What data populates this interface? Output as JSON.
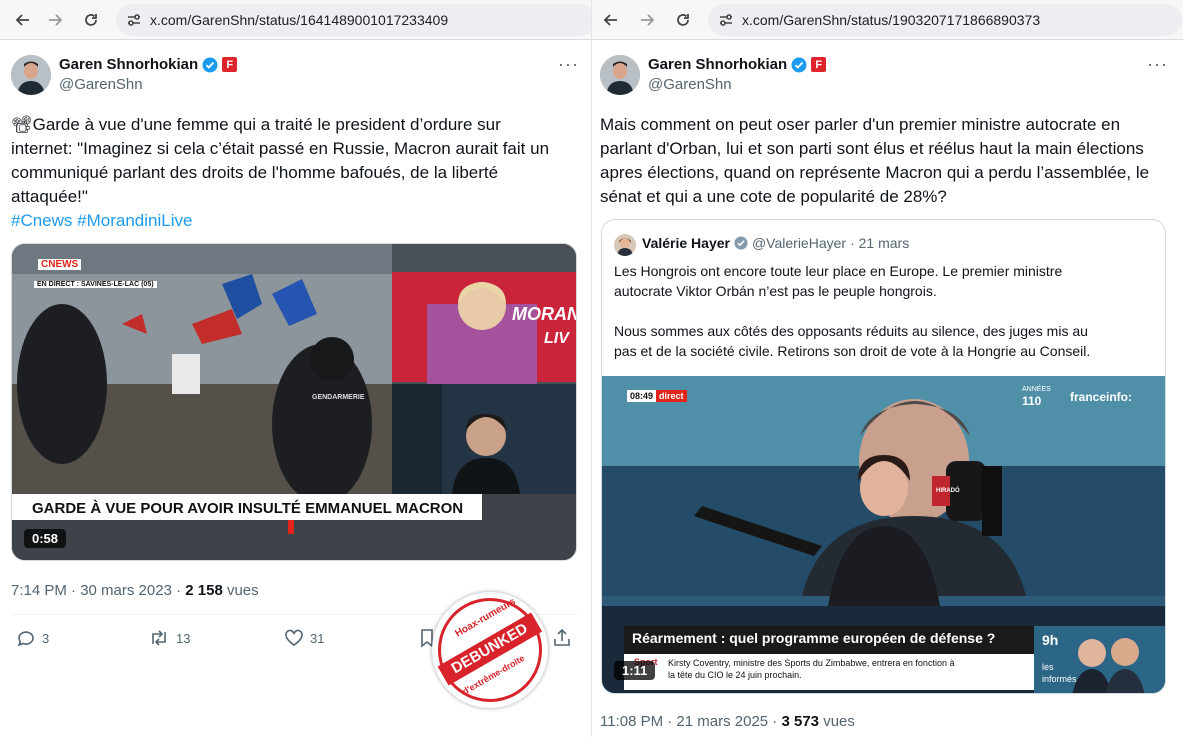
{
  "left": {
    "browser": {
      "url": "x.com/GarenShn/status/1641489001017233409"
    },
    "author": {
      "name": "Garen Shnorhokian",
      "handle": "@GarenShn",
      "affiliation_badge": "F"
    },
    "tweet": {
      "camera_emoji": "📽",
      "line1": "Garde à vue d'une femme qui a traité le president d’ordure sur",
      "line2": "internet: \"Imaginez si cela c’était passé en Russie, Macron aurait fait un",
      "line3": "communiqué parlant des droits de l'homme bafoués, de la liberté",
      "line4": "attaquée!\"",
      "hashtag1": "#Cnews",
      "hashtag2": "#MorandiniLive"
    },
    "video": {
      "channel_logo": "CNEWS",
      "live_strip": "EN DIRECT : SAVINES-LE-LAC (05)",
      "show_name_1": "MORAN",
      "show_name_2": "LIV",
      "banner": "GARDE À VUE POUR AVOIR INSULTÉ EMMANUEL MACRON",
      "duration": "0:58",
      "gendarmerie_label": "GENDARMERIE"
    },
    "meta": {
      "time": "7:14 PM · 30 mars 2023 · ",
      "views": "2 158",
      "views_label": " vues"
    },
    "actions": {
      "replies": "3",
      "retweets": "13",
      "likes": "31"
    },
    "stamp": {
      "top": "Hoax-rumeurs",
      "middle": "DEBUNKED",
      "bottom": "d'extrême-droite"
    }
  },
  "right": {
    "browser": {
      "url": "x.com/GarenShn/status/1903207171866890373"
    },
    "author": {
      "name": "Garen Shnorhokian",
      "handle": "@GarenShn",
      "affiliation_badge": "F"
    },
    "tweet": {
      "line1": "Mais comment on peut oser parler d'un premier ministre autocrate en",
      "line2": "parlant d'Orban, lui et son parti sont élus et réélus haut la main élections",
      "line3": "apres élections, quand on représente Macron qui a perdu l’assemblée, le",
      "line4": "sénat et qui a une cote de popularité de 28%?"
    },
    "quote": {
      "name": "Valérie Hayer",
      "handle": "@ValerieHayer",
      "date": "· 21 mars",
      "p1_line1": "Les Hongrois ont encore toute leur place en Europe. Le premier ministre",
      "p1_line2": "autocrate Viktor Orbán n’est pas le peuple hongrois.",
      "p2_line1": "Nous sommes aux côtés des opposants réduits au silence, des juges mis au",
      "p2_line2": "pas et de la société civile. Retirons son droit de vote à la Hongrie au Conseil."
    },
    "video": {
      "time_tag": "08:49",
      "live_tag": "direct",
      "anniv": "110",
      "anniv_small": "ANNÉES",
      "brand": "franceinfo:",
      "banner": "Réarmement : quel programme européen de défense ?",
      "ticker_label": "Sport",
      "ticker_line1": "Kirsty Coventry, ministre des Sports du Zimbabwe, entrera en fonction à",
      "ticker_line2": "la tête du CIO le 24 juin prochain.",
      "side_hour": "9h",
      "side_show_1": "les",
      "side_show_2": "informés",
      "duration": "1:11",
      "mic_label": "HIRADÓ"
    },
    "meta": {
      "time": "11:08 PM · 21 mars 2025 · ",
      "views": "3 573",
      "views_label": " vues"
    }
  }
}
